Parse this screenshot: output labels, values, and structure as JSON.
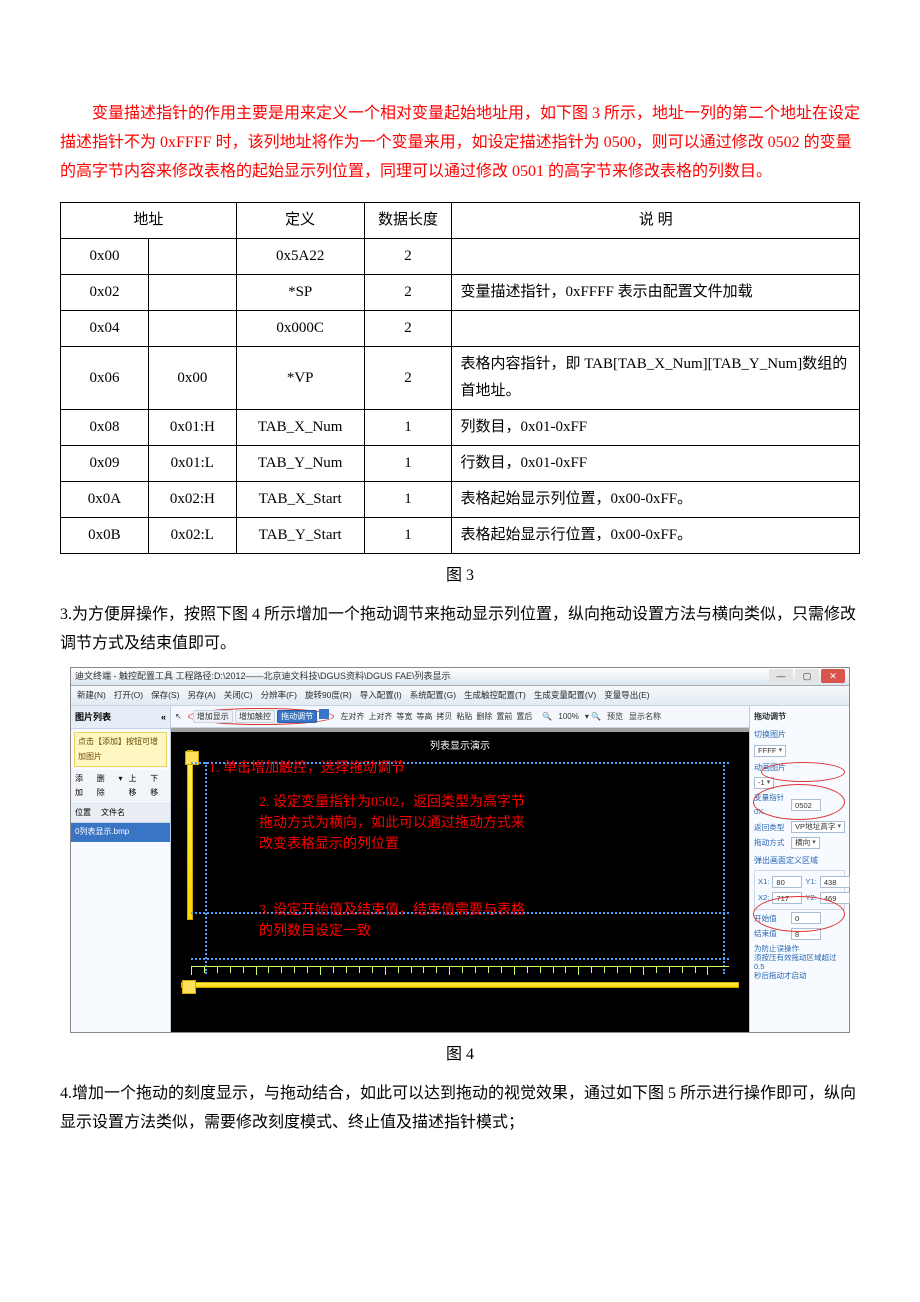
{
  "intro_red": "变量描述指针的作用主要是用来定义一个相对变量起始地址用，如下图 3 所示，地址一列的第二个地址在设定描述指针不为 0xFFFF 时，该列地址将作为一个变量来用，如设定描述指针为 0500，则可以通过修改 0502 的变量的高字节内容来修改表格的起始显示列位置，同理可以通过修改 0501 的高字节来修改表格的列数目。",
  "table": {
    "headers": [
      "地址",
      "",
      "定义",
      "数据长度",
      "说 明"
    ],
    "rows": [
      [
        "0x00",
        "",
        "0x5A22",
        "2",
        ""
      ],
      [
        "0x02",
        "",
        "*SP",
        "2",
        "变量描述指针，0xFFFF 表示由配置文件加载"
      ],
      [
        "0x04",
        "",
        "0x000C",
        "2",
        ""
      ],
      [
        "0x06",
        "0x00",
        "*VP",
        "2",
        "表格内容指针，即 TAB[TAB_X_Num][TAB_Y_Num]数组的首地址。"
      ],
      [
        "0x08",
        "0x01:H",
        "TAB_X_Num",
        "1",
        "列数目，0x01-0xFF"
      ],
      [
        "0x09",
        "0x01:L",
        "TAB_Y_Num",
        "1",
        "行数目，0x01-0xFF"
      ],
      [
        "0x0A",
        "0x02:H",
        "TAB_X_Start",
        "1",
        "表格起始显示列位置，0x00-0xFF。"
      ],
      [
        "0x0B",
        "0x02:L",
        "TAB_Y_Start",
        "1",
        "表格起始显示行位置，0x00-0xFF。"
      ]
    ]
  },
  "caption3": "图 3",
  "para3": "3.为方便屏操作，按照下图 4 所示增加一个拖动调节来拖动显示列位置，纵向拖动设置方法与横向类似，只需修改调节方式及结束值即可。",
  "caption4": "图 4",
  "para4": "4.增加一个拖动的刻度显示，与拖动结合，如此可以达到拖动的视觉效果，通过如下图 5 所示进行操作即可，纵向显示设置方法类似，需要修改刻度模式、终止值及描述指针模式；",
  "app": {
    "title": "迪文终端 - 触控配置工具 工程路径:D:\\2012——北京迪文科技\\DGUS资料\\DGUS FAE\\列表显示",
    "menus": [
      "新建(N)",
      "打开(O)",
      "保存(S)",
      "另存(A)",
      "关闭(C)",
      "分辨率(F)",
      "旋转90度(R)",
      "导入配置(I)",
      "系统配置(G)",
      "生成触控配置(T)",
      "生成变量配置(V)",
      "变量导出(E)"
    ],
    "left": {
      "title": "图片列表",
      "collapse": "«",
      "tip": "点击【添加】按钮可增加图片",
      "bar": [
        "添加",
        "删除",
        "▾",
        "上移",
        "下移"
      ],
      "head": [
        "位置",
        "文件名"
      ],
      "item": "0列表显示.bmp"
    },
    "toolbar": {
      "items": [
        "增加显示",
        "增加触控"
      ],
      "selected": "拖动调节",
      "after": [
        "左对齐",
        "上对齐",
        "等宽",
        "等高",
        "拷贝",
        "粘贴",
        "删除",
        "置前",
        "置后"
      ],
      "zoom": "100%",
      "tail": [
        "预览",
        "显示名称"
      ]
    },
    "canvas_title": "列表显示演示",
    "anno1": "1. 单击增加触控，选择拖动调节",
    "anno2": "2. 设定变量指针为0502，返回类型为高字节\n拖动方式为横向，如此可以通过拖动方式来\n改变表格显示的列位置",
    "anno3": "3. 设定开始值及结束值，结束值需要与表格\n的列数目设定一致",
    "right": {
      "title": "拖动调节",
      "sec1": "切换图片",
      "ffff": "FFFF",
      "sec2": "动画图片",
      "neg1": "-1",
      "vp_lab": "变量指针0X",
      "vp_val": "0502",
      "ret_lab": "返回类型",
      "ret_val": "VP地址高字",
      "mode_lab": "拖动方式",
      "mode_val": "横向",
      "area_title": "弹出画面定义区域",
      "x1_lab": "X1:",
      "x1_val": "80",
      "y1_lab": "Y1:",
      "y1_val": "438",
      "x2_lab": "X2:",
      "x2_val": "717",
      "y2_lab": "Y2:",
      "y2_val": "469",
      "start_lab": "开始值",
      "start_val": "0",
      "end_lab": "结束值",
      "end_val": "8",
      "note": "为防止误操作\n须按压有效拖动区域超过0.5\n秒后拖动才启动"
    }
  }
}
